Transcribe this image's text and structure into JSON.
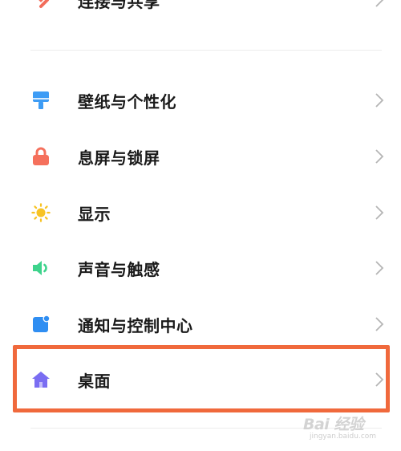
{
  "settings": {
    "items": [
      {
        "label": "连接与共享",
        "icon": "share-link-icon",
        "color": "#f26d5b"
      },
      {
        "label": "壁纸与个性化",
        "icon": "paint-brush-icon",
        "color": "#3d9cf5"
      },
      {
        "label": "息屏与锁屏",
        "icon": "lock-icon",
        "color": "#f5705c"
      },
      {
        "label": "显示",
        "icon": "sun-icon",
        "color": "#f7c325"
      },
      {
        "label": "声音与触感",
        "icon": "speaker-icon",
        "color": "#3ed38c"
      },
      {
        "label": "通知与控制中心",
        "icon": "notification-icon",
        "color": "#2f8ef2"
      },
      {
        "label": "桌面",
        "icon": "home-icon",
        "color": "#7a6df2"
      }
    ],
    "highlighted_item": "桌面",
    "highlight_color": "#f0693c"
  },
  "watermark": {
    "brand": "Bai 经验",
    "url": "jingyan.baidu.com"
  }
}
